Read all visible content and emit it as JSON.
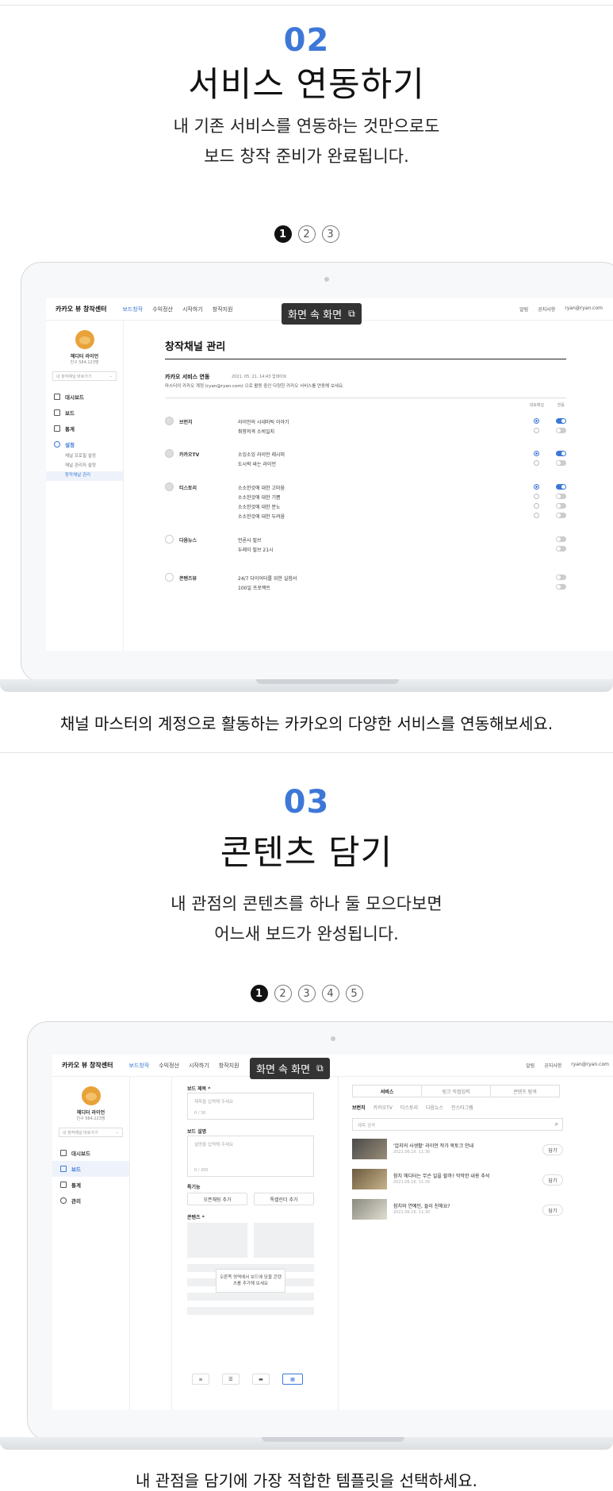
{
  "section2": {
    "number": "02",
    "title": "서비스 연동하기",
    "desc_line1": "내 기존 서비스를 연동하는 것만으로도",
    "desc_line2": "보드 창작 준비가 완료됩니다.",
    "steps": [
      "1",
      "2",
      "3"
    ],
    "caption": "채널 마스터의 계정으로 활동하는 카카오의 다양한 서비스를 연동해보세요.",
    "app": {
      "brand": "카카오 뷰 창작센터",
      "nav": [
        "보드창작",
        "수익정산",
        "시작하기",
        "창작지원"
      ],
      "hdr_right": [
        "알림",
        "공지사항",
        "ryan@ryan.com"
      ],
      "pip": "화면 속 화면",
      "profile_name": "헤디터 라이언",
      "profile_friends": "친구 584,123명",
      "channel_select": "내 창작채널 바로가기",
      "menu": [
        "대시보드",
        "보드",
        "통계",
        "설정"
      ],
      "submenu": [
        "채널 프로필 설정",
        "채널 관리자 설정",
        "창작채널 관리"
      ],
      "page_title": "창작채널 관리",
      "link_title": "카카오 서비스 연동",
      "link_date": "2021. 05. 21. 14:43 업데이트",
      "link_desc": "마스터의 카카오 계정 (ryan@ryan.com) 으로 활동 중인 다양한 카카오 서비스를 연동해 보세요.",
      "col_headers": [
        "대표채널",
        "연동"
      ],
      "services": [
        {
          "name": "브런치",
          "items": [
            "라이언의 시네마틱 이야기",
            "취향저격 소비일지"
          ]
        },
        {
          "name": "카카오TV",
          "items": [
            "소잉소잉 라이언 레시피",
            "도시락 싸는 라이언"
          ]
        },
        {
          "name": "티스토리",
          "items": [
            "소소한것에 대한 고마움",
            "소소한것에 대한 기쁨",
            "소소한것에 대한 분노",
            "소소한것에 대한 두려움"
          ]
        },
        {
          "name": "다음뉴스",
          "items": [
            "언론사 필브",
            "두레이 필브 21시"
          ]
        },
        {
          "name": "콘텐츠뷰",
          "items": [
            "24/7 다이어터를 위한 실험서",
            "100일 프로젝트"
          ]
        }
      ]
    }
  },
  "section3": {
    "number": "03",
    "title": "콘텐츠 담기",
    "desc_line1": "내 관점의 콘텐츠를 하나 둘 모으다보면",
    "desc_line2": "어느새 보드가 완성됩니다.",
    "steps": [
      "1",
      "2",
      "3",
      "4",
      "5"
    ],
    "caption": "내 관점을 담기에 가장 적합한 템플릿을 선택하세요.",
    "app": {
      "brand": "카카오 뷰 창작센터",
      "nav": [
        "보드창작",
        "수익정산",
        "시작하기",
        "창작지원"
      ],
      "hdr_right": [
        "알림",
        "공지사항",
        "ryan@ryan.com"
      ],
      "pip": "화면 속 화면",
      "profile_name": "헤디터 라이언",
      "profile_friends": "친구 584,123명",
      "channel_select": "내 창작채널 바로가기",
      "menu": [
        "대시보드",
        "보드",
        "통계",
        "관리"
      ],
      "board_title_label": "보드 제목 *",
      "board_title_ph": "제목을 입력해 주세요",
      "board_title_count": "0 / 30",
      "board_desc_label": "보드 설명",
      "board_desc_ph": "설명을 입력해 주세요",
      "board_desc_count": "0 / 300",
      "feature_label": "특기능",
      "feature_btns": [
        "오픈채팅 추가",
        "톡캘린더 추가"
      ],
      "content_label": "콘텐츠 *",
      "drop_hint": "오른쪽 영역에서 보드에 담을 콘텐츠를 추가해 보세요",
      "right_tabs": [
        "서비스",
        "링크 직접입력",
        "콘텐츠 탐색"
      ],
      "sub_tabs": [
        "브런치",
        "카카오TV",
        "티스토리",
        "다음뉴스",
        "인스타그램"
      ],
      "search_ph": "제목 검색",
      "articles": [
        {
          "title": "'압지의 사생활' 라이언 작가 북토크 안내",
          "date": "2021.06.16. 11:30",
          "btn": "담기"
        },
        {
          "title": "참치 헤디터는 무슨 일을 할까? 막막한 내용 추석",
          "date": "2021.06.16. 11:30",
          "btn": "담기"
        },
        {
          "title": "참치와 연예인, 들이 친해요?",
          "date": "2021.06.16. 11:30",
          "btn": "담기"
        }
      ]
    }
  }
}
